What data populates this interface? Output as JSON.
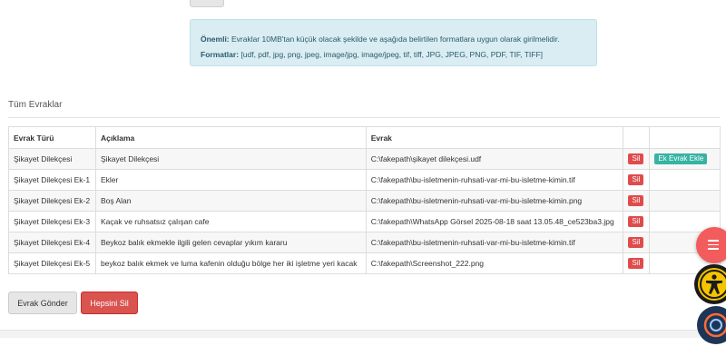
{
  "info": {
    "onemli_label": "Önemli:",
    "onemli_text": " Evraklar 10MB'tan küçük olacak şekilde ve aşağıda belirtilen formatlara uygun olarak girilmelidir.",
    "formatlar_label": "Formatlar:",
    "formatlar_text": " [udf, pdf, jpg, png, jpeg, image/jpg, image/jpeg, tif, tiff, JPG, JPEG, PNG, PDF, TIF, TIFF]"
  },
  "section_title": "Tüm Evraklar",
  "table": {
    "headers": {
      "type": "Evrak Türü",
      "desc": "Açıklama",
      "file": "Evrak"
    },
    "rows": [
      {
        "type": "Şikayet Dilekçesi",
        "desc": "Şikayet Dilekçesi",
        "file": "C:\\fakepath\\şikayet dilekçesi.udf",
        "delete": "Sil",
        "add": "Ek Evrak Ekle"
      },
      {
        "type": "Şikayet Dilekçesi Ek-1",
        "desc": "Ekler",
        "file": "C:\\fakepath\\bu-isletmenin-ruhsati-var-mi-bu-isletme-kimin.tif",
        "delete": "Sil"
      },
      {
        "type": "Şikayet Dilekçesi Ek-2",
        "desc": "Boş Alan",
        "file": "C:\\fakepath\\bu-isletmenin-ruhsati-var-mi-bu-isletme-kimin.png",
        "delete": "Sil"
      },
      {
        "type": "Şikayet Dilekçesi Ek-3",
        "desc": "Kaçak ve ruhsatsız çalışan cafe",
        "file": "C:\\fakepath\\WhatsApp Görsel 2025-08-18 saat 13.05.48_ce523ba3.jpg",
        "delete": "Sil"
      },
      {
        "type": "Şikayet Dilekçesi Ek-4",
        "desc": "Beykoz balık ekmekle ilgili gelen cevaplar yıkım kararu",
        "file": "C:\\fakepath\\bu-isletmenin-ruhsati-var-mi-bu-isletme-kimin.tif",
        "delete": "Sil"
      },
      {
        "type": "Şikayet Dilekçesi Ek-5",
        "desc": "beykoz balık ekmek ve luma kafenin olduğu bölge her iki işletme yeri kacak",
        "file": "C:\\fakepath\\Screenshot_222.png",
        "delete": "Sil"
      }
    ]
  },
  "buttons": {
    "send": "Evrak Gönder",
    "delete_all": "Hepsini Sil"
  },
  "icons": {
    "menu": "menu-icon",
    "accessibility": "accessibility-icon",
    "chat": "chat-support-icon"
  },
  "colors": {
    "danger": "#e04b4b",
    "teal": "#37b3a4",
    "info_bg": "#d9edf3",
    "fab_red": "#f25c5c",
    "access_yellow": "#f5c400"
  }
}
